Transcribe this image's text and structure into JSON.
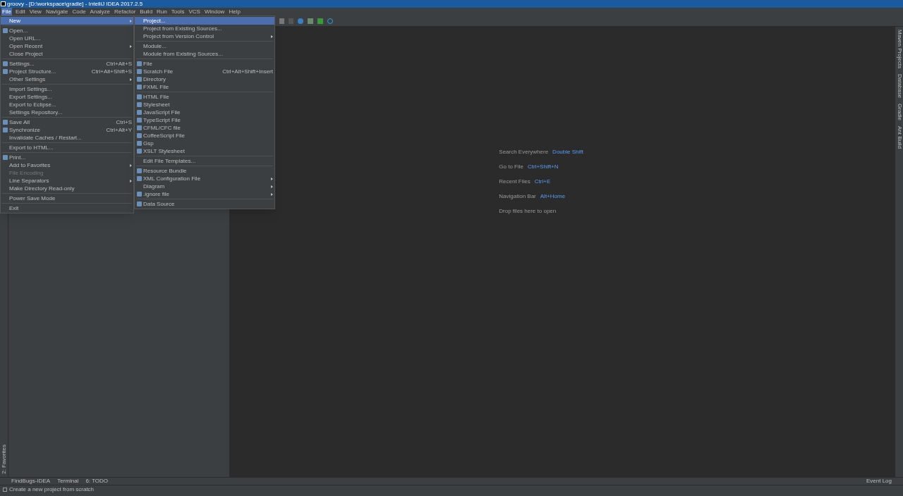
{
  "window": {
    "title": "groovy - [D:\\workspace\\gradle] - IntelliJ IDEA 2017.2.5"
  },
  "menu_bar": [
    {
      "label": "File",
      "selected": true
    },
    {
      "label": "Edit",
      "selected": false
    },
    {
      "label": "View",
      "selected": false
    },
    {
      "label": "Navigate",
      "selected": false
    },
    {
      "label": "Code",
      "selected": false
    },
    {
      "label": "Analyze",
      "selected": false
    },
    {
      "label": "Refactor",
      "selected": false
    },
    {
      "label": "Build",
      "selected": false
    },
    {
      "label": "Run",
      "selected": false
    },
    {
      "label": "Tools",
      "selected": false
    },
    {
      "label": "VCS",
      "selected": false
    },
    {
      "label": "Window",
      "selected": false
    },
    {
      "label": "Help",
      "selected": false
    }
  ],
  "file_menu": [
    {
      "kind": "item",
      "label": "New",
      "selected": true,
      "submenu": true
    },
    {
      "kind": "separator"
    },
    {
      "kind": "item",
      "label": "Open...",
      "selected": false,
      "icon": true
    },
    {
      "kind": "item",
      "label": "Open URL...",
      "selected": false
    },
    {
      "kind": "item",
      "label": "Open Recent",
      "selected": false,
      "submenu": true
    },
    {
      "kind": "item",
      "label": "Close Project",
      "selected": false
    },
    {
      "kind": "separator"
    },
    {
      "kind": "item",
      "label": "Settings...",
      "selected": false,
      "icon": true,
      "shortcut": "Ctrl+Alt+S"
    },
    {
      "kind": "item",
      "label": "Project Structure...",
      "selected": false,
      "icon": true,
      "shortcut": "Ctrl+Alt+Shift+S"
    },
    {
      "kind": "item",
      "label": "Other Settings",
      "selected": false,
      "submenu": true
    },
    {
      "kind": "separator"
    },
    {
      "kind": "item",
      "label": "Import Settings...",
      "selected": false
    },
    {
      "kind": "item",
      "label": "Export Settings...",
      "selected": false
    },
    {
      "kind": "item",
      "label": "Export to Eclipse...",
      "selected": false
    },
    {
      "kind": "item",
      "label": "Settings Repository...",
      "selected": false
    },
    {
      "kind": "separator"
    },
    {
      "kind": "item",
      "label": "Save All",
      "selected": false,
      "icon": true,
      "shortcut": "Ctrl+S"
    },
    {
      "kind": "item",
      "label": "Synchronize",
      "selected": false,
      "icon": true,
      "shortcut": "Ctrl+Alt+Y"
    },
    {
      "kind": "item",
      "label": "Invalidate Caches / Restart...",
      "selected": false
    },
    {
      "kind": "separator"
    },
    {
      "kind": "item",
      "label": "Export to HTML...",
      "selected": false
    },
    {
      "kind": "separator"
    },
    {
      "kind": "item",
      "label": "Print...",
      "selected": false,
      "icon": true
    },
    {
      "kind": "item",
      "label": "Add to Favorites",
      "selected": false,
      "submenu": true
    },
    {
      "kind": "item",
      "label": "File Encoding",
      "selected": false,
      "disabled": true
    },
    {
      "kind": "item",
      "label": "Line Separators",
      "selected": false,
      "submenu": true
    },
    {
      "kind": "item",
      "label": "Make Directory Read-only",
      "selected": false
    },
    {
      "kind": "separator"
    },
    {
      "kind": "item",
      "label": "Power Save Mode",
      "selected": false
    },
    {
      "kind": "separator"
    },
    {
      "kind": "item",
      "label": "Exit",
      "selected": false
    }
  ],
  "new_submenu": [
    {
      "kind": "item",
      "label": "Project...",
      "selected": true
    },
    {
      "kind": "item",
      "label": "Project from Existing Sources...",
      "selected": false
    },
    {
      "kind": "item",
      "label": "Project from Version Control",
      "selected": false,
      "submenu": true
    },
    {
      "kind": "separator"
    },
    {
      "kind": "item",
      "label": "Module...",
      "selected": false
    },
    {
      "kind": "item",
      "label": "Module from Existing Sources...",
      "selected": false
    },
    {
      "kind": "separator"
    },
    {
      "kind": "item",
      "label": "File",
      "selected": false,
      "icon": true
    },
    {
      "kind": "item",
      "label": "Scratch File",
      "selected": false,
      "icon": true,
      "shortcut": "Ctrl+Alt+Shift+Insert"
    },
    {
      "kind": "item",
      "label": "Directory",
      "selected": false,
      "icon": true
    },
    {
      "kind": "item",
      "label": "FXML File",
      "selected": false,
      "icon": true
    },
    {
      "kind": "separator"
    },
    {
      "kind": "item",
      "label": "HTML File",
      "selected": false,
      "icon": true
    },
    {
      "kind": "item",
      "label": "Stylesheet",
      "selected": false,
      "icon": true
    },
    {
      "kind": "item",
      "label": "JavaScript File",
      "selected": false,
      "icon": true
    },
    {
      "kind": "item",
      "label": "TypeScript File",
      "selected": false,
      "icon": true
    },
    {
      "kind": "item",
      "label": "CFML/CFC file",
      "selected": false,
      "icon": true
    },
    {
      "kind": "item",
      "label": "CoffeeScript File",
      "selected": false,
      "icon": true
    },
    {
      "kind": "item",
      "label": "Gsp",
      "selected": false,
      "icon": true
    },
    {
      "kind": "item",
      "label": "XSLT Stylesheet",
      "selected": false,
      "icon": true
    },
    {
      "kind": "separator"
    },
    {
      "kind": "item",
      "label": "Edit File Templates...",
      "selected": false
    },
    {
      "kind": "separator"
    },
    {
      "kind": "item",
      "label": "Resource Bundle",
      "selected": false,
      "icon": true
    },
    {
      "kind": "item",
      "label": "XML Configuration File",
      "selected": false,
      "icon": true,
      "submenu": true
    },
    {
      "kind": "item",
      "label": "Diagram",
      "selected": false,
      "submenu": true
    },
    {
      "kind": "item",
      "label": ".ignore file",
      "selected": false,
      "icon": true,
      "submenu": true
    },
    {
      "kind": "separator"
    },
    {
      "kind": "item",
      "label": "Data Source",
      "selected": false,
      "icon": true
    }
  ],
  "editor_hints": [
    {
      "label": "Search Everywhere",
      "shortcut": "Double Shift"
    },
    {
      "label": "Go to File",
      "shortcut": "Ctrl+Shift+N"
    },
    {
      "label": "Recent Files",
      "shortcut": "Ctrl+E"
    },
    {
      "label": "Navigation Bar",
      "shortcut": "Alt+Home"
    },
    {
      "label": "Drop files here to open"
    }
  ],
  "right_tool_windows": [
    "Maven Projects",
    "Database",
    "Gradle",
    "Ant Build"
  ],
  "left_tool_windows": [
    "2: Favorites"
  ],
  "bottom_tool_windows": [
    "FindBugs-IDEA",
    "Terminal",
    "6: TODO"
  ],
  "event_log": "Event Log",
  "status_bar": "Create a new project from scratch"
}
